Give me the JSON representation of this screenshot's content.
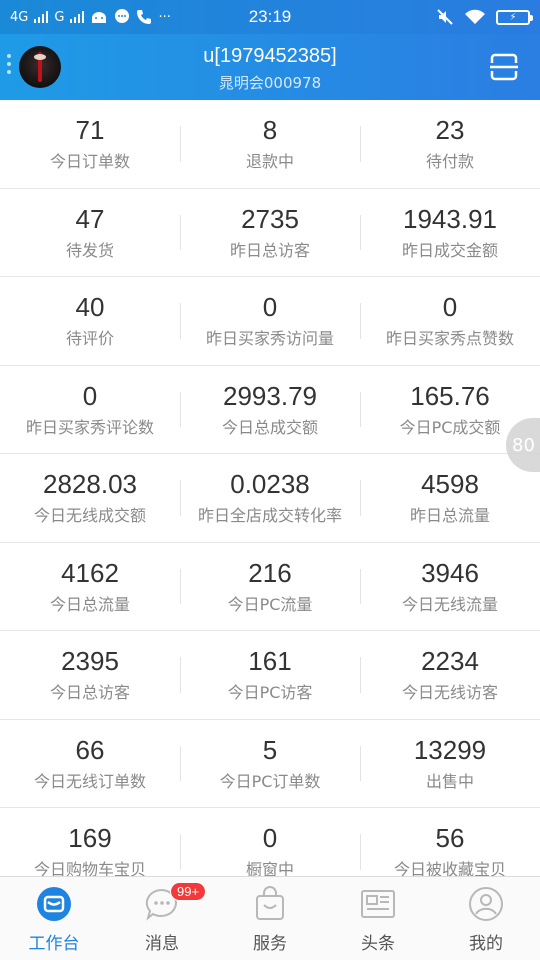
{
  "status_bar": {
    "network1": "4G",
    "network2": "G",
    "more": "···",
    "time": "23:19",
    "battery": "⚡"
  },
  "header": {
    "title": "u[1979452385]",
    "subtitle": "晁明会000978"
  },
  "stats": [
    [
      {
        "value": "71",
        "label": "今日订单数"
      },
      {
        "value": "8",
        "label": "退款中"
      },
      {
        "value": "23",
        "label": "待付款"
      }
    ],
    [
      {
        "value": "47",
        "label": "待发货"
      },
      {
        "value": "2735",
        "label": "昨日总访客"
      },
      {
        "value": "1943.91",
        "label": "昨日成交金额"
      }
    ],
    [
      {
        "value": "40",
        "label": "待评价"
      },
      {
        "value": "0",
        "label": "昨日买家秀访问量"
      },
      {
        "value": "0",
        "label": "昨日买家秀点赞数"
      }
    ],
    [
      {
        "value": "0",
        "label": "昨日买家秀评论数"
      },
      {
        "value": "2993.79",
        "label": "今日总成交额"
      },
      {
        "value": "165.76",
        "label": "今日PC成交额"
      }
    ],
    [
      {
        "value": "2828.03",
        "label": "今日无线成交额"
      },
      {
        "value": "0.0238",
        "label": "昨日全店成交转化率"
      },
      {
        "value": "4598",
        "label": "昨日总流量"
      }
    ],
    [
      {
        "value": "4162",
        "label": "今日总流量"
      },
      {
        "value": "216",
        "label": "今日PC流量"
      },
      {
        "value": "3946",
        "label": "今日无线流量"
      }
    ],
    [
      {
        "value": "2395",
        "label": "今日总访客"
      },
      {
        "value": "161",
        "label": "今日PC访客"
      },
      {
        "value": "2234",
        "label": "今日无线访客"
      }
    ],
    [
      {
        "value": "66",
        "label": "今日无线订单数"
      },
      {
        "value": "5",
        "label": "今日PC订单数"
      },
      {
        "value": "13299",
        "label": "出售中"
      }
    ],
    [
      {
        "value": "169",
        "label": "今日购物车宝贝"
      },
      {
        "value": "0",
        "label": "橱窗中"
      },
      {
        "value": "56",
        "label": "今日被收藏宝贝"
      }
    ]
  ],
  "float_badge": "80",
  "tabs": [
    {
      "label": "工作台",
      "icon": "workbench-icon",
      "active": true
    },
    {
      "label": "消息",
      "icon": "message-icon",
      "badge": "99+"
    },
    {
      "label": "服务",
      "icon": "service-bag-icon"
    },
    {
      "label": "头条",
      "icon": "news-icon"
    },
    {
      "label": "我的",
      "icon": "profile-icon"
    }
  ],
  "colors": {
    "brand": "#1f84e0",
    "badge": "#f23a3a"
  }
}
